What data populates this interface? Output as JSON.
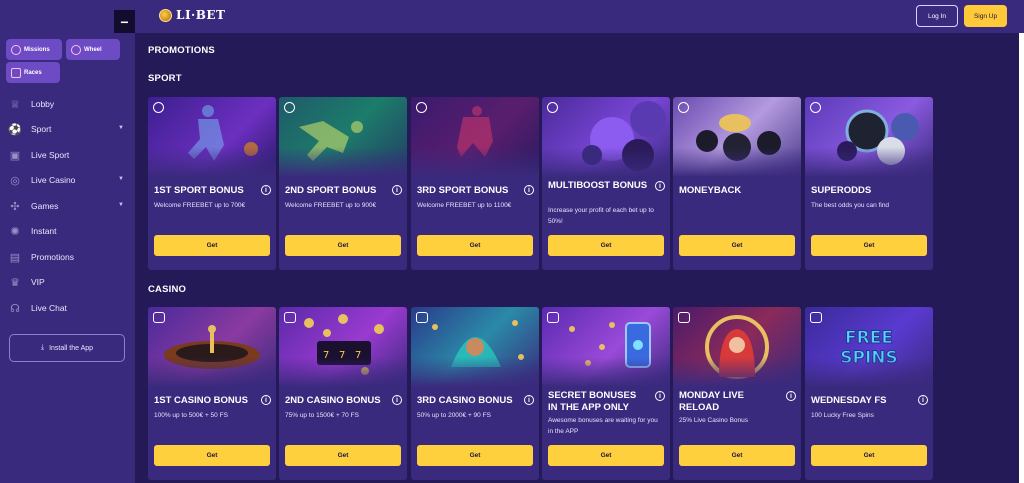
{
  "header": {
    "logo_text": "LI·BET",
    "collapse_icon": "minus",
    "login_label": "Log In",
    "signup_label": "Sign Up",
    "accent_color": "#ffc93a"
  },
  "sidebar": {
    "chips": [
      {
        "label": "Missions",
        "icon": "target-icon"
      },
      {
        "label": "Wheel",
        "icon": "wheel-icon"
      },
      {
        "label": "Races",
        "icon": "races-icon"
      }
    ],
    "items": [
      {
        "label": "Lobby",
        "icon": "trophy-icon",
        "has_caret": false
      },
      {
        "label": "Sport",
        "icon": "soccer-ball-icon",
        "has_caret": true
      },
      {
        "label": "Live Sport",
        "icon": "live-sport-icon",
        "has_caret": false
      },
      {
        "label": "Live Casino",
        "icon": "live-casino-icon",
        "has_caret": true
      },
      {
        "label": "Games",
        "icon": "gamepad-icon",
        "has_caret": true
      },
      {
        "label": "Instant",
        "icon": "instant-icon",
        "has_caret": false
      },
      {
        "label": "Promotions",
        "icon": "gift-icon",
        "has_caret": false
      },
      {
        "label": "VIP",
        "icon": "crown-icon",
        "has_caret": false
      },
      {
        "label": "Live Chat",
        "icon": "headset-icon",
        "has_caret": false
      }
    ],
    "install_label": "Install the App"
  },
  "main": {
    "page_title": "PROMOTIONS",
    "sections": [
      {
        "title": "SPORT",
        "cards": [
          {
            "title": "1ST SPORT BONUS",
            "desc": "Welcome FREEBET up to 700€",
            "button": "Get",
            "icon": "soccer-ball-icon",
            "has_info": true
          },
          {
            "title": "2ND SPORT BONUS",
            "desc": "Welcome FREEBET up to 900€",
            "button": "Get",
            "icon": "soccer-ball-icon",
            "has_info": true
          },
          {
            "title": "3RD SPORT BONUS",
            "desc": "Welcome FREEBET up to 1100€",
            "button": "Get",
            "icon": "soccer-ball-icon",
            "has_info": true
          },
          {
            "title": "MULTIBOOST BONUS",
            "desc": "Increase your profit of each bet up to 50%!",
            "button": "Get",
            "icon": "soccer-ball-icon",
            "has_info": true
          },
          {
            "title": "MONEYBACK",
            "desc": "",
            "button": "Get",
            "icon": "soccer-ball-icon",
            "has_info": false
          },
          {
            "title": "SUPERODDS",
            "desc": "The best odds you can find",
            "button": "Get",
            "icon": "soccer-ball-icon",
            "has_info": false
          }
        ]
      },
      {
        "title": "CASINO",
        "cards": [
          {
            "title": "1ST CASINO BONUS",
            "desc": "100% up to 500€ + 50 FS",
            "button": "Get",
            "icon": "casino-cherries-icon",
            "has_info": true
          },
          {
            "title": "2ND CASINO BONUS",
            "desc": "75% up to 1500€ + 70 FS",
            "button": "Get",
            "icon": "casino-cherries-icon",
            "has_info": true
          },
          {
            "title": "3RD CASINO BONUS",
            "desc": "50% up to 2000€ + 90 FS",
            "button": "Get",
            "icon": "casino-cherries-icon",
            "has_info": true
          },
          {
            "title": "SECRET BONUSES IN THE APP ONLY",
            "desc": "Awesome bonuses are waiting for you in the APP",
            "button": "Get",
            "icon": "casino-cherries-icon",
            "has_info": true
          },
          {
            "title": "MONDAY LIVE RELOAD",
            "desc": "25% Live Casino Bonus",
            "button": "Get",
            "icon": "casino-cherries-icon",
            "has_info": true
          },
          {
            "title": "WEDNESDAY FS",
            "desc": "100 Lucky Free Spins",
            "button": "Get",
            "icon": "casino-cherries-icon",
            "has_info": true
          }
        ]
      }
    ],
    "banner_texts": {
      "free_spins": "FREE SPINS"
    }
  }
}
